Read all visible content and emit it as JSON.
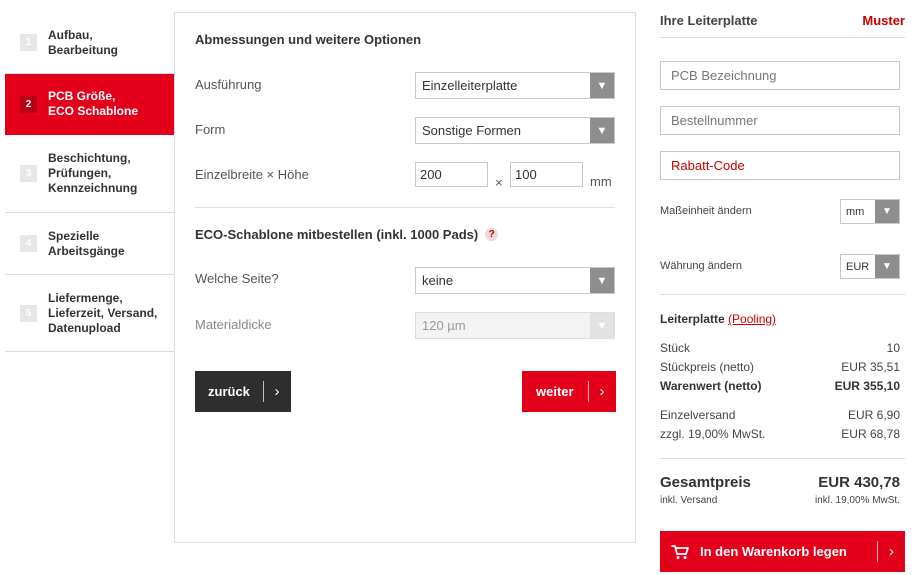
{
  "steps": [
    {
      "num": "1",
      "label_line1": "Aufbau,",
      "label_line2": "Bearbeitung",
      "label_line3": ""
    },
    {
      "num": "2",
      "label_line1": "PCB Größe,",
      "label_line2": "ECO Schablone",
      "label_line3": ""
    },
    {
      "num": "3",
      "label_line1": "Beschichtung,",
      "label_line2": "Prüfungen,",
      "label_line3": "Kennzeichnung"
    },
    {
      "num": "4",
      "label_line1": "Spezielle",
      "label_line2": "Arbeitsgänge",
      "label_line3": ""
    },
    {
      "num": "5",
      "label_line1": "Liefermenge,",
      "label_line2": "Lieferzeit, Versand,",
      "label_line3": "Datenupload"
    }
  ],
  "active_step": 2,
  "main": {
    "dimensions_title": "Abmessungen und weitere Optionen",
    "execution_label": "Ausführung",
    "execution_value": "Einzelleiterplatte",
    "form_label": "Form",
    "form_value": "Sonstige Formen",
    "size_label": "Einzelbreite × Höhe",
    "width_value": "200",
    "height_value": "100",
    "times_symbol": "×",
    "unit": "mm",
    "eco_title": "ECO-Schablone mitbestellen (inkl. 1000 Pads)",
    "help_symbol": "?",
    "side_label": "Welche Seite?",
    "side_value": "keine",
    "thickness_label": "Materialdicke",
    "thickness_value": "120 µm",
    "back_label": "zurück",
    "next_label": "weiter",
    "chevron": "›"
  },
  "sidebar": {
    "title": "Ihre Leiterplatte",
    "sample": "Muster",
    "pcb_name_placeholder": "PCB Bezeichnung",
    "order_number_placeholder": "Bestellnummer",
    "promo_placeholder": "Rabatt-Code",
    "unit_label": "Maßeinheit ändern",
    "unit_value": "mm",
    "currency_label": "Währung ändern",
    "currency_value": "EUR",
    "summary_title": "Leiterplatte",
    "pooling_link": "(Pooling)",
    "rows": [
      {
        "label": "Stück",
        "value": "10"
      },
      {
        "label": "Stückpreis (netto)",
        "value": "EUR 35,51"
      },
      {
        "label": "Warenwert (netto)",
        "value": "EUR 355,10"
      },
      {
        "label": "Einzelversand",
        "value": "EUR 6,90"
      },
      {
        "label": "zzgl. 19,00% MwSt.",
        "value": "EUR 68,78"
      }
    ],
    "total_label": "Gesamtpreis",
    "total_value": "EUR 430,78",
    "total_sub_left": "inkl. Versand",
    "total_sub_right": "inkl. 19,00% MwSt.",
    "cart_label": "In den Warenkorb legen"
  },
  "colors": {
    "accent": "#e2001a",
    "dark_button": "#2e2e2e",
    "select_arrow": "#8e8e8e"
  }
}
